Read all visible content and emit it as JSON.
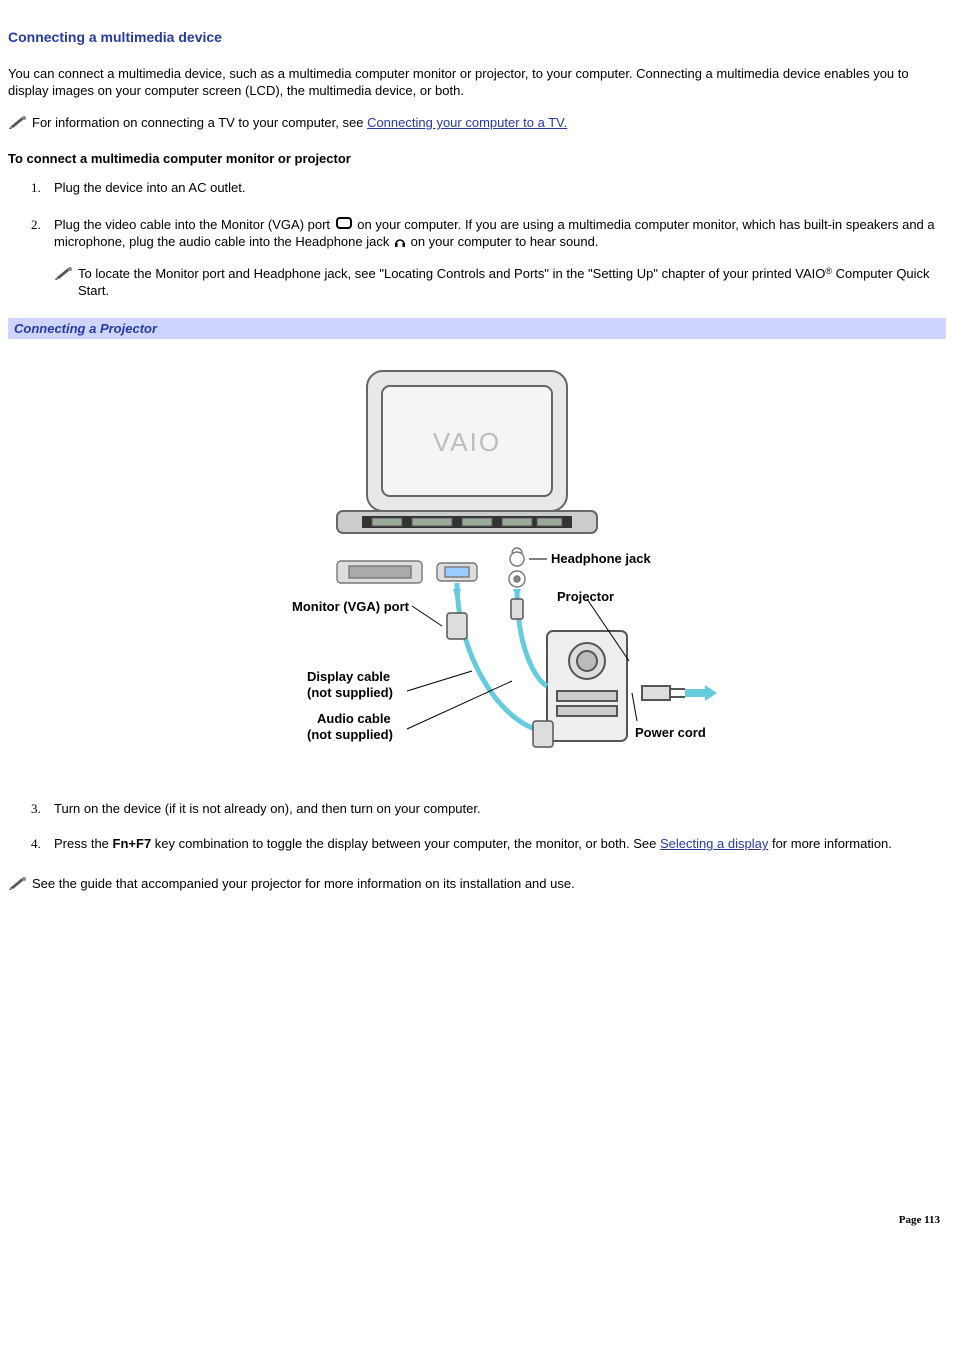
{
  "title": "Connecting a multimedia device",
  "intro": "You can connect a multimedia device, such as a multimedia computer monitor or projector, to your computer. Connecting a multimedia device enables you to display images on your computer screen (LCD), the multimedia device, or both.",
  "tvnote_pre": "For information on connecting a TV to your computer, see ",
  "tvnote_link": "Connecting your computer to a TV.",
  "sub_head": "To connect a multimedia computer monitor or projector",
  "step1": "Plug the device into an AC outlet.",
  "step2_a": "Plug the video cable into the Monitor (VGA) port ",
  "step2_b": " on your computer. If you are using a multimedia computer monitor, which has built-in speakers and a microphone, plug the audio cable into the Headphone jack ",
  "step2_c": " on your computer to hear sound.",
  "step2_note_a": "To locate the Monitor port and Headphone jack, see \"Locating Controls and Ports\" in the \"Setting Up\" chapter of your printed VAIO",
  "step2_note_b": " Computer Quick Start.",
  "reg": "®",
  "section_bar": "Connecting a Projector",
  "fig": {
    "headphone": "Headphone jack",
    "projector": "Projector",
    "vga": "Monitor (VGA) port",
    "dcable1": "Display cable",
    "dcable2": "(not supplied)",
    "acable1": "Audio cable",
    "acable2": "(not supplied)",
    "power": "Power cord"
  },
  "step3": "Turn on the device (if it is not already on), and then turn on your computer.",
  "step4_a": "Press the ",
  "step4_key": "Fn+F7",
  "step4_b": " key combination to toggle the display between your computer, the monitor, or both. See ",
  "step4_link": "Selecting a display",
  "step4_c": " for more information.",
  "endnote": "See the guide that accompanied your projector for more information on its installation and use.",
  "page": "Page 113"
}
